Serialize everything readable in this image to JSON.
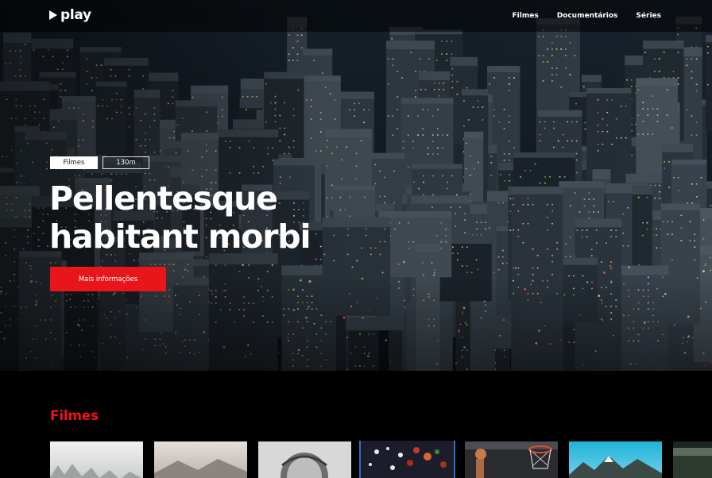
{
  "header": {
    "logo_text": "play",
    "nav": [
      "Filmes",
      "Documentários",
      "Séries"
    ]
  },
  "hero": {
    "badges": [
      "Filmes",
      "130m"
    ],
    "title_line1": "Pellentesque",
    "title_line2": "habitant morbi",
    "cta_label": "Mais informações",
    "image": "aerial-city-night"
  },
  "row": {
    "title": "Filmes",
    "cards": [
      {
        "image": "foggy-forest",
        "active": false
      },
      {
        "image": "misty-mountains",
        "active": false
      },
      {
        "image": "bw-portrait",
        "active": false
      },
      {
        "image": "colorful-food",
        "active": true
      },
      {
        "image": "basketball-hoop",
        "active": false
      },
      {
        "image": "mountain-lake",
        "active": false
      },
      {
        "image": "dark-landscape",
        "active": false
      }
    ]
  },
  "colors": {
    "accent": "#e8161b",
    "active_outline": "#2b6fd6",
    "background": "#000000"
  }
}
